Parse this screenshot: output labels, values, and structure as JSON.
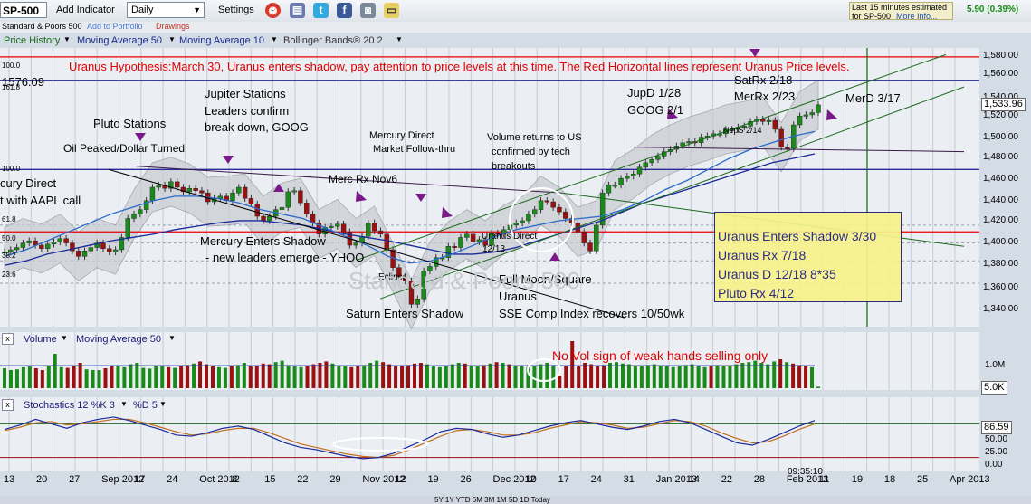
{
  "toolbar": {
    "symbol": "SP-500",
    "add_indicator": "Add Indicator",
    "period": "Daily",
    "settings": "Settings",
    "quote_line1": "Last 15 minutes estimated",
    "quote_line2": "for SP-500",
    "quote_more": "More Info...",
    "quote_change": "5.90 (0.39%)"
  },
  "subbar": {
    "name": "Standard & Poors 500",
    "add_portfolio": "Add to Portfolio",
    "drawings": "Drawings"
  },
  "indicators": {
    "price_history": "Price History",
    "ma50": "Moving Average 50",
    "ma10": "Moving Average 10",
    "bollinger": "Bollinger Bands® 20 2"
  },
  "annotations": {
    "headline": "Uranus Hypothesis:March 30, Uranus enters shadow, pay attention to price levels at this time. The Red Horizontal lines represent Uranus Price levels.",
    "price_1576": "1576.09",
    "level_100_top": "100.0",
    "level_1616": "161.8",
    "level_100_mid": "100.0",
    "level_618": "61.8",
    "level_500": "50.0",
    "level_382": "38.2",
    "level_236": "23.6",
    "mercury_direct_left": "cury Direct",
    "aapl_call": "t with AAPL call",
    "pluto_stations": "Pluto Stations",
    "oil_peaked": "Oil Peaked/Dollar Turned",
    "jupiter_stations": "Jupiter Stations",
    "leaders_confirm": "Leaders confirm",
    "break_down": "break down, GOOG",
    "mercury_direct_1": "Mercury Direct",
    "market_follow": "Market Follow-thru",
    "merc_rx": "Merc Rx Nov6",
    "volume_returns": "Volume returns to US",
    "confirmed_tech": "confirmed by tech",
    "breakouts": "breakouts",
    "mercury_enters_shadow": "Mercury Enters Shadow",
    "new_leaders": "- new leaders emerge - YHOO",
    "eclipse": "Eclipse",
    "saturn_shadow": "Saturn Enters Shadow",
    "full_moon": "Full Moon/Square",
    "uranus_word": "Uranus",
    "sse_comp": "SSE Comp Index recovers 10/50wk",
    "uranus_direct": "Uranus Direct",
    "uranus_direct_date": "12/13",
    "jupd": "JupD 1/28",
    "goog": "GOOG 2/1",
    "satrx": "SatRx 2/18",
    "merrx": "MerRx 2/23",
    "neps": "NepS 2/14",
    "merd": "MerD 3/17",
    "box_line1": "Uranus Enters Shadow 3/30",
    "box_line2": "Uranus Rx 7/18",
    "box_line3": "Uranus D 12/18 8*35",
    "box_line4": "Pluto Rx 4/12",
    "watermark": "Standard & Poors 500",
    "no_vol": "No Vol sign of weak hands selling only",
    "time_stamp": "09:35:10"
  },
  "price_axis": {
    "labels": [
      "1,580.00",
      "1,560.00",
      "1,540.00",
      "1,520.00",
      "1,500.00",
      "1,480.00",
      "1,460.00",
      "1,440.00",
      "1,420.00",
      "1,400.00",
      "1,380.00",
      "1,360.00",
      "1,340.00"
    ],
    "current": "1,533.96"
  },
  "volume_panel": {
    "title": "Volume",
    "ma": "Moving Average 50",
    "axis_label": "1.0M",
    "current": "5.0K"
  },
  "stoch_panel": {
    "title": "Stochastics 12 %K 3",
    "d": "%D 5",
    "axis": [
      "50.00",
      "25.00",
      "0.00"
    ],
    "current": "86.59"
  },
  "x_axis": {
    "labels": [
      "13",
      "20",
      "27",
      "Sep 2012",
      "17",
      "24",
      "Oct 2012",
      "8",
      "15",
      "22",
      "29",
      "Nov 2012",
      "12",
      "19",
      "26",
      "Dec 2012",
      "10",
      "17",
      "24",
      "31",
      "Jan 2013",
      "14",
      "22",
      "28",
      "Feb 2013",
      "11",
      "19",
      "18",
      "25",
      "Apr 2013"
    ],
    "extra": [
      "2012",
      "7",
      "4",
      "7",
      "31",
      "8"
    ]
  },
  "bottom": {
    "ranges": "5Y 1Y YTD 6M 3M 1M 5D 1D Today"
  },
  "colors": {
    "up": "#1a8a1a",
    "down": "#9b1010",
    "uranus_red": "#ee0000",
    "box_fill": "#f7f28a",
    "navy": "#1a1a7a"
  },
  "chart_data": {
    "type": "candlestick",
    "title": "SP-500",
    "ylim": [
      1335,
      1585
    ],
    "x_range": [
      "2012-08-13",
      "2013-04-08"
    ],
    "uranus_levels": [
      1577,
      1420
    ],
    "blue_levels": [
      1556,
      1476
    ],
    "series": [
      {
        "name": "Price History",
        "values": [
          1402,
          1404,
          1406,
          1410,
          1412,
          1408,
          1405,
          1409,
          1411,
          1414,
          1410,
          1403,
          1398,
          1403,
          1406,
          1410,
          1405,
          1402,
          1404,
          1415,
          1432,
          1436,
          1440,
          1448,
          1460,
          1462,
          1459,
          1465,
          1460,
          1456,
          1459,
          1457,
          1455,
          1447,
          1450,
          1452,
          1448,
          1455,
          1460,
          1450,
          1445,
          1434,
          1430,
          1434,
          1440,
          1442,
          1456,
          1457,
          1446,
          1436,
          1428,
          1418,
          1424,
          1425,
          1427,
          1420,
          1408,
          1410,
          1416,
          1428,
          1421,
          1418,
          1404,
          1388,
          1380,
          1376,
          1355,
          1360,
          1385,
          1389,
          1397,
          1397,
          1407,
          1406,
          1415,
          1418,
          1411,
          1413,
          1408,
          1419,
          1418,
          1422,
          1426,
          1428,
          1430,
          1436,
          1440,
          1448,
          1447,
          1442,
          1438,
          1432,
          1428,
          1420,
          1410,
          1403,
          1426,
          1455,
          1462,
          1462,
          1468,
          1470,
          1472,
          1478,
          1482,
          1485,
          1488,
          1492,
          1494,
          1497,
          1500,
          1501,
          1500,
          1505,
          1506,
          1508,
          1508,
          1512,
          1512,
          1514,
          1515,
          1519,
          1521,
          1519,
          1520,
          1512,
          1496,
          1495,
          1516,
          1524,
          1525,
          1527,
          1534
        ]
      },
      {
        "name": "Moving Average 50",
        "values": [
          1390,
          1394,
          1400,
          1404,
          1408,
          1412,
          1415,
          1418,
          1422,
          1425,
          1428,
          1430,
          1430,
          1428,
          1426,
          1422,
          1418,
          1415,
          1412,
          1408,
          1404,
          1400,
          1400,
          1402,
          1406,
          1412,
          1418,
          1424,
          1430,
          1438,
          1446,
          1452,
          1458,
          1464,
          1470,
          1476,
          1482,
          1486,
          1490
        ]
      },
      {
        "name": "Moving Average 10",
        "values": [
          1398,
          1404,
          1412,
          1420,
          1428,
          1436,
          1442,
          1448,
          1452,
          1452,
          1450,
          1446,
          1440,
          1436,
          1432,
          1424,
          1416,
          1408,
          1398,
          1392,
          1394,
          1400,
          1408,
          1416,
          1422,
          1426,
          1430,
          1432,
          1434,
          1440,
          1448,
          1458,
          1466,
          1476,
          1486,
          1494,
          1500,
          1506,
          1510
        ]
      },
      {
        "name": "Stochastics %K",
        "values": [
          70,
          78,
          88,
          80,
          72,
          82,
          88,
          92,
          86,
          78,
          70,
          60,
          58,
          64,
          72,
          76,
          70,
          58,
          46,
          38,
          34,
          28,
          22,
          18,
          20,
          28,
          40,
          52,
          66,
          72,
          70,
          62,
          56,
          60,
          68,
          76,
          82,
          86,
          80,
          74,
          70,
          76,
          84,
          88,
          82,
          70,
          58,
          46,
          42,
          52,
          64,
          76,
          86
        ]
      },
      {
        "name": "%D",
        "values": [
          68,
          74,
          82,
          84,
          78,
          80,
          84,
          88,
          88,
          82,
          74,
          66,
          60,
          62,
          68,
          72,
          72,
          64,
          54,
          44,
          38,
          32,
          26,
          22,
          20,
          24,
          34,
          46,
          58,
          68,
          70,
          66,
          60,
          60,
          64,
          72,
          78,
          84,
          82,
          78,
          72,
          74,
          80,
          86,
          84,
          76,
          64,
          54,
          46,
          48,
          58,
          70,
          80
        ]
      },
      {
        "name": "Volume",
        "values": [
          0.55,
          0.5,
          0.52,
          0.58,
          0.6,
          0.55,
          0.5,
          0.62,
          0.95,
          0.58,
          0.56,
          0.6,
          0.7,
          0.52,
          0.5,
          0.5,
          0.55,
          0.6,
          0.62,
          0.58,
          0.66,
          0.7,
          0.56,
          0.54,
          0.6,
          0.62,
          0.58,
          0.56,
          0.6,
          0.64,
          0.68,
          0.74,
          0.66,
          0.6,
          0.58,
          0.56,
          0.6,
          0.64,
          0.7,
          0.6,
          0.62,
          0.68,
          0.66,
          0.72,
          0.76,
          0.64,
          0.6,
          0.58,
          0.62,
          0.66,
          0.7,
          0.74,
          0.68,
          0.62,
          0.6,
          0.58,
          0.62,
          0.64,
          0.7,
          0.76,
          0.72,
          0.66,
          0.62,
          0.6,
          0.64,
          0.68,
          0.7,
          0.66,
          0.6,
          0.58,
          0.62,
          0.66,
          0.7,
          0.68,
          0.62,
          0.6,
          0.64,
          0.68,
          0.72,
          0.7,
          0.66,
          0.62,
          0.6,
          0.58,
          0.62,
          0.66,
          0.7,
          0.64,
          0.35,
          0.62,
          1.3,
          0.6,
          0.7,
          0.66,
          0.62,
          0.64,
          0.7,
          0.72,
          0.68,
          0.66,
          0.62,
          0.6,
          0.64,
          0.66,
          0.62,
          0.6,
          0.58,
          0.62,
          0.64,
          0.66,
          0.6,
          0.58,
          0.62,
          0.64,
          0.6,
          0.62,
          0.66,
          0.7,
          0.72,
          0.76,
          0.7,
          0.66,
          0.74,
          0.8,
          0.72,
          0.68,
          0.64,
          0.6,
          0.58,
          0.04
        ]
      }
    ]
  }
}
